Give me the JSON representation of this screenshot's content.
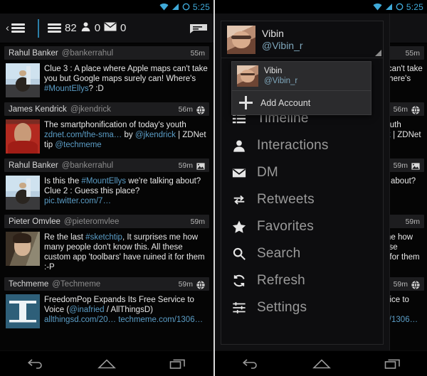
{
  "status_bar": {
    "time": "5:25",
    "icons": [
      "wifi-icon",
      "cell-signal-icon",
      "sync-icon"
    ],
    "accent_color": "#3fa9d8"
  },
  "action_bar": {
    "back_chevron": "‹",
    "drawer_icon": "list-icon",
    "counters": [
      {
        "icon": "timeline-icon",
        "value": "82"
      },
      {
        "icon": "person-icon",
        "value": "0"
      },
      {
        "icon": "envelope-icon",
        "value": "0"
      }
    ],
    "compose_icon": "compose-icon"
  },
  "timeline": {
    "tweets": [
      {
        "name": "Rahul Banker",
        "handle": "@bankerrahul",
        "time": "55m",
        "badge": "",
        "avatar": "av-rahul",
        "segments": [
          {
            "t": "Clue 3 : A place where Apple maps can't take you but Google maps surely can! Where's ",
            "k": "plain"
          },
          {
            "t": "#MountEllys",
            "k": "tag"
          },
          {
            "t": "? :D",
            "k": "plain"
          }
        ]
      },
      {
        "name": "James Kendrick",
        "handle": "@jkendrick",
        "time": "56m",
        "badge": "globe-icon",
        "avatar": "av-james",
        "segments": [
          {
            "t": "The smartphonification of today's youth ",
            "k": "plain"
          },
          {
            "t": "zdnet.com/the-sma…",
            "k": "lnk"
          },
          {
            "t": " by ",
            "k": "plain"
          },
          {
            "t": "@jkendrick",
            "k": "men"
          },
          {
            "t": " | ZDNet tip ",
            "k": "plain"
          },
          {
            "t": "@techmeme",
            "k": "men"
          }
        ]
      },
      {
        "name": "Rahul Banker",
        "handle": "@bankerrahul",
        "time": "59m",
        "badge": "photo-icon",
        "avatar": "av-rahul",
        "segments": [
          {
            "t": "Is this the ",
            "k": "plain"
          },
          {
            "t": "#MountEllys",
            "k": "tag"
          },
          {
            "t": " we're talking about? Clue 2 : Guess this place? ",
            "k": "plain"
          },
          {
            "t": "pic.twitter.com/7…",
            "k": "lnk"
          }
        ]
      },
      {
        "name": "Pieter Omvlee",
        "handle": "@pieteromvlee",
        "time": "59m",
        "badge": "",
        "avatar": "av-pieter",
        "segments": [
          {
            "t": "Re the last ",
            "k": "plain"
          },
          {
            "t": "#sketchtip",
            "k": "tag"
          },
          {
            "t": ", It surprises me how many people don't know this. All these custom app 'toolbars' have ruined it for them :-P",
            "k": "plain"
          }
        ]
      },
      {
        "name": "Techmeme",
        "handle": "@Techmeme",
        "time": "59m",
        "badge": "globe-icon",
        "avatar": "av-techmeme",
        "segments": [
          {
            "t": "FreedomPop Expands Its Free Service to Voice (",
            "k": "plain"
          },
          {
            "t": "@inafried",
            "k": "men"
          },
          {
            "t": " / AllThingsD) ",
            "k": "plain"
          },
          {
            "t": "allthingsd.com/20…",
            "k": "lnk"
          },
          {
            "t": " ",
            "k": "plain"
          },
          {
            "t": "techmeme.com/1306…",
            "k": "lnk"
          }
        ]
      }
    ]
  },
  "drawer": {
    "account": {
      "name": "Vibin",
      "handle": "@Vibin_r",
      "avatar": "av-vibin"
    },
    "dropdown": {
      "accounts": [
        {
          "name": "Vibin",
          "handle": "@Vibin_r",
          "avatar": "av-vibin"
        }
      ],
      "add_account_label": "Add Account",
      "add_icon": "plus-icon"
    },
    "menu_items": [
      {
        "label": "Timeline",
        "icon": "list-icon"
      },
      {
        "label": "Interactions",
        "icon": "person-icon"
      },
      {
        "label": "DM",
        "icon": "envelope-icon"
      },
      {
        "label": "Retweets",
        "icon": "retweet-icon"
      },
      {
        "label": "Favorites",
        "icon": "star-icon"
      },
      {
        "label": "Search",
        "icon": "magnifier-icon"
      },
      {
        "label": "Refresh",
        "icon": "refresh-icon"
      },
      {
        "label": "Settings",
        "icon": "sliders-icon"
      }
    ]
  },
  "nav_bar": {
    "buttons": [
      {
        "name": "back-button",
        "icon": "back-arrow-icon"
      },
      {
        "name": "home-button",
        "icon": "home-icon"
      },
      {
        "name": "recents-button",
        "icon": "recents-icon"
      }
    ]
  }
}
